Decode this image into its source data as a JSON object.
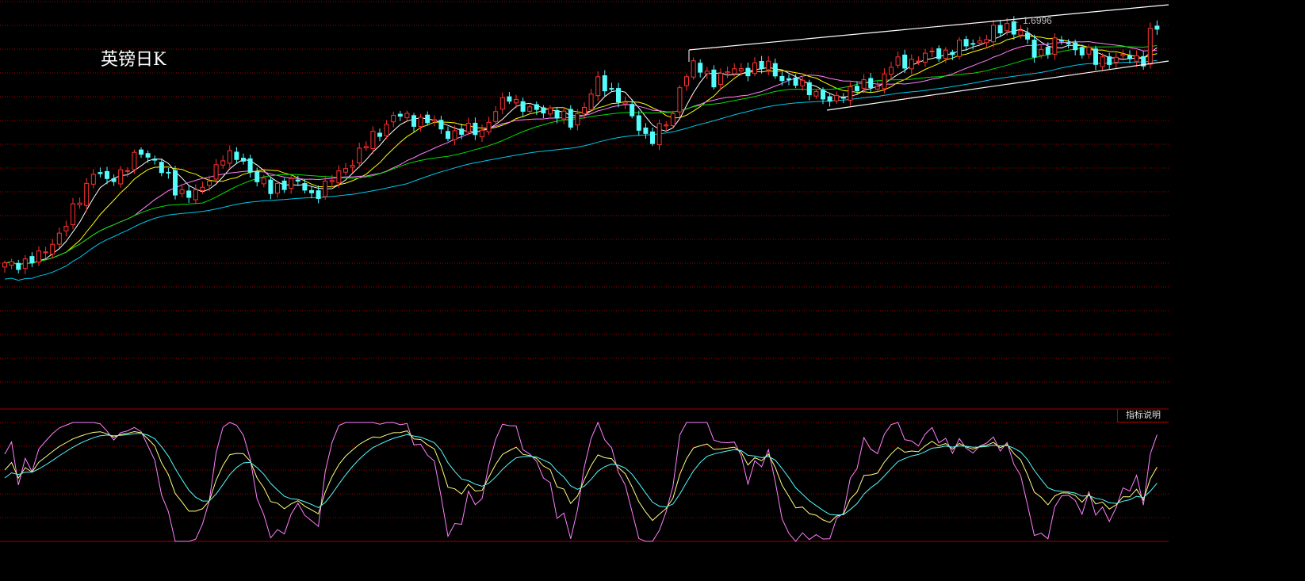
{
  "title": "英镑日K",
  "indicator_button": "指标说明",
  "colors": {
    "up": "#ff3232",
    "down": "#54fcfc",
    "grid": "#a00000",
    "ma5": "#ffffff",
    "ma10": "#ffff00",
    "ma20": "#ff80ff",
    "ma30": "#00e000",
    "ma60": "#00c8e8",
    "k": "#ffff80",
    "d": "#54fcfc",
    "j": "#ff80ff"
  },
  "chart_data": {
    "type": "candlestick",
    "title": "英镑日K",
    "max_label": "1.6996",
    "price_range": [
      1.25,
      1.72
    ],
    "moving_averages": [
      5,
      10,
      20,
      30,
      60
    ],
    "indicator": {
      "name": "KDJ",
      "params": [
        9,
        3,
        3
      ],
      "range": [
        0,
        100
      ]
    },
    "close_keypoints": [
      [
        0,
        1.401
      ],
      [
        5,
        1.411
      ],
      [
        9,
        1.452
      ],
      [
        13,
        1.519
      ],
      [
        15,
        1.504
      ],
      [
        20,
        1.54
      ],
      [
        22,
        1.534
      ],
      [
        25,
        1.493
      ],
      [
        29,
        1.493
      ],
      [
        32,
        1.54
      ],
      [
        35,
        1.529
      ],
      [
        39,
        1.493
      ],
      [
        42,
        1.509
      ],
      [
        45,
        1.488
      ],
      [
        49,
        1.514
      ],
      [
        54,
        1.56
      ],
      [
        57,
        1.586
      ],
      [
        62,
        1.581
      ],
      [
        65,
        1.565
      ],
      [
        70,
        1.57
      ],
      [
        74,
        1.612
      ],
      [
        77,
        1.591
      ],
      [
        80,
        1.596
      ],
      [
        83,
        1.576
      ],
      [
        87,
        1.627
      ],
      [
        90,
        1.612
      ],
      [
        93,
        1.57
      ],
      [
        95,
        1.56
      ],
      [
        98,
        1.586
      ],
      [
        99,
        1.627
      ],
      [
        101,
        1.648
      ],
      [
        104,
        1.632
      ],
      [
        107,
        1.643
      ],
      [
        112,
        1.648
      ],
      [
        115,
        1.627
      ],
      [
        118,
        1.622
      ],
      [
        121,
        1.601
      ],
      [
        123,
        1.617
      ],
      [
        128,
        1.627
      ],
      [
        130,
        1.648
      ],
      [
        134,
        1.658
      ],
      [
        139,
        1.668
      ],
      [
        144,
        1.684
      ],
      [
        147,
        1.699
      ],
      [
        149,
        1.689
      ],
      [
        151,
        1.663
      ],
      [
        155,
        1.679
      ],
      [
        159,
        1.663
      ],
      [
        160,
        1.653
      ],
      [
        162,
        1.658
      ],
      [
        167,
        1.658
      ],
      [
        168,
        1.689
      ],
      [
        169,
        1.694
      ]
    ]
  }
}
